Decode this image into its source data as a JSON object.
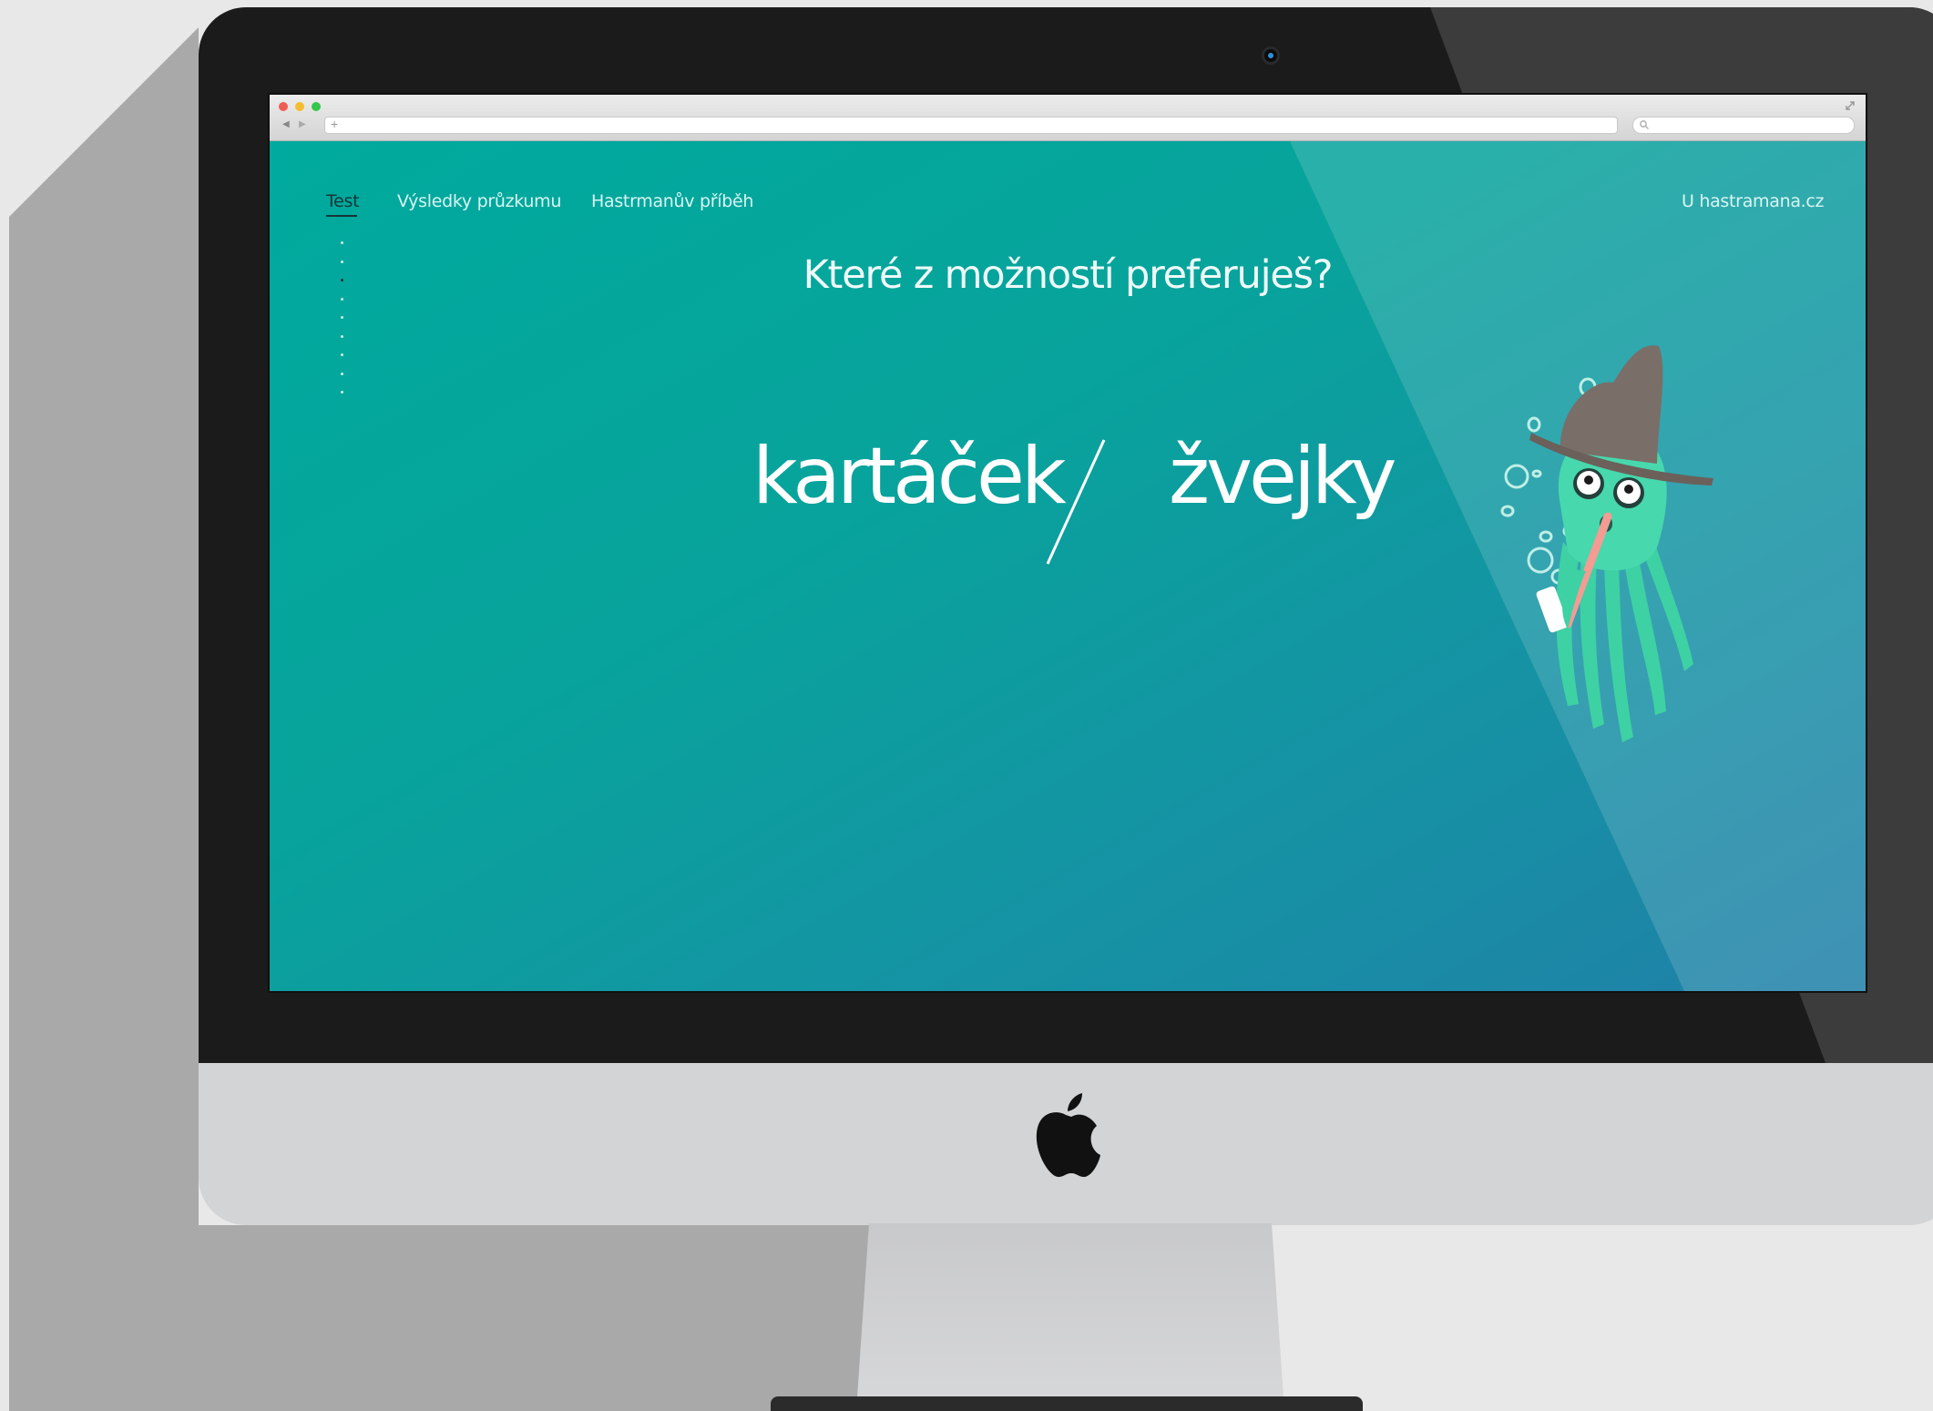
{
  "nav": {
    "test": "Test",
    "results": "Výsledky průzkumu",
    "story": "Hastrmanův příběh",
    "home": "U hastramana.cz"
  },
  "question": "Které z možností preferuješ?",
  "options": {
    "left": "kartáček",
    "right": "žvejky"
  },
  "browser": {
    "url_placeholder": "+"
  },
  "progress": {
    "total_steps": 9,
    "current_step": 3
  },
  "colors": {
    "page_gradient_start": "#00aa9d",
    "page_gradient_end": "#2080a8",
    "octopus_body": "#3ed1a4",
    "hat": "#7a6e68"
  },
  "icons": [
    "apple-logo-icon",
    "search-icon",
    "fullscreen-icon",
    "back-arrow-icon",
    "forward-arrow-icon",
    "octopus-illustration"
  ]
}
